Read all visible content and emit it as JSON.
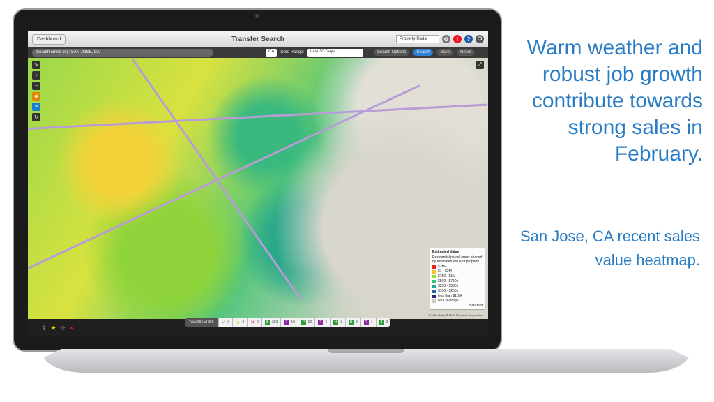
{
  "app": {
    "title": "Transfer Search",
    "dashboard_label": "Dashboard",
    "account_select": "Property Radar"
  },
  "search": {
    "value": "Search entire city: SAN JOSE, CA",
    "state": "CA",
    "date_range_label": "Date Range:",
    "date_range": "Last 30 Days",
    "search_options": "Search Options",
    "search": "Search",
    "save": "Save",
    "reset": "Reset"
  },
  "legend": {
    "title": "Estimated Value",
    "description": "Residential parcel areas shaded by estimated value of property",
    "items": [
      {
        "label": "$2M+",
        "color": "#e8231e"
      },
      {
        "label": "$1 - $2M",
        "color": "#f5c22c"
      },
      {
        "label": "$750 - $1M",
        "color": "#8fe03a"
      },
      {
        "label": "$500 - $750k",
        "color": "#2bc47a"
      },
      {
        "label": "$250 - $500k",
        "color": "#23a9a0"
      },
      {
        "label": "$100 - $250k",
        "color": "#1a6fa0"
      },
      {
        "label": "less than $100k",
        "color": "#1c2a80"
      },
      {
        "label": "No Coverage",
        "color": "#cccccc"
      }
    ],
    "scale": "2500 feet",
    "copyright": "© 2015 Nokia  © 2015 Microsoft Corporation"
  },
  "status": {
    "total": "Total 366 of 366",
    "counts": [
      {
        "icon": "check",
        "value": "0",
        "color": "#888"
      },
      {
        "icon": "star",
        "value": "0",
        "color": "#e6c200"
      },
      {
        "icon": "x",
        "value": "0",
        "color": "#d22"
      },
      {
        "icon": "$",
        "value": "283",
        "color": "#2e9a3a"
      },
      {
        "icon": "?",
        "value": "10",
        "color": "#8a2aa0"
      },
      {
        "icon": "P",
        "value": "52",
        "color": "#2e9a3a"
      },
      {
        "icon": "?",
        "value": "6",
        "color": "#8a2aa0"
      },
      {
        "icon": "H",
        "value": "3",
        "color": "#2e9a3a"
      },
      {
        "icon": "B",
        "value": "8",
        "color": "#2e9a3a"
      },
      {
        "icon": "?",
        "value": "1",
        "color": "#8a2aa0"
      },
      {
        "icon": "$",
        "value": "3",
        "color": "#2e9a3a"
      }
    ]
  },
  "marketing": {
    "headline": "Warm weather and robust job growth contribute towards strong sales in February.",
    "caption": "San Jose, CA  recent sales value heatmap."
  }
}
